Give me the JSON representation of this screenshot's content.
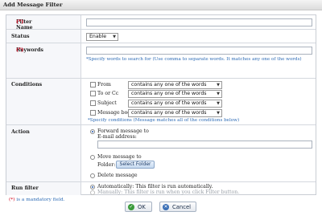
{
  "window": {
    "title": "Add Message Filter"
  },
  "required_marker": "(*)",
  "filter_name": {
    "label": "Filter Name",
    "value": ""
  },
  "status": {
    "label": "Status",
    "selected": "Enable"
  },
  "keywords": {
    "label": "Keywords",
    "value": "",
    "hint": "*Specify words to search for (Use comma to separate words. It matches any one of the words)"
  },
  "conditions": {
    "label": "Conditions",
    "items": [
      {
        "label": "From",
        "checked": false,
        "operator": "contains any one of the words",
        "value": ""
      },
      {
        "label": "To or Cc",
        "checked": false,
        "operator": "contains any one of the words",
        "value": ""
      },
      {
        "label": "Subject",
        "checked": false,
        "operator": "contains any one of the words",
        "value": ""
      },
      {
        "label": "Message body",
        "checked": false,
        "operator": "contains any one of the words",
        "value": ""
      }
    ],
    "hint": "*Specify conditions (Message matches all of the conditions below)"
  },
  "action": {
    "label": "Action",
    "forward": {
      "label": "Forward message to",
      "selected": true,
      "email_label": "E-mail address:",
      "email_value": ""
    },
    "move": {
      "label": "Move message to",
      "selected": false,
      "folder_label": "Folder:",
      "select_folder_button": "Select Folder"
    },
    "delete": {
      "label": "Delete message",
      "selected": false
    }
  },
  "run_filter": {
    "label": "Run filter",
    "automatic": {
      "label": "Automatically: This filter is run automatically.",
      "selected": true
    },
    "manual": {
      "label": "Manually: This filter is run when you click Filter button.",
      "selected": false,
      "disabled": true
    }
  },
  "mandatory_note": {
    "marker": "(*)",
    "text": " is a mandatory field."
  },
  "buttons": {
    "ok": "OK",
    "cancel": "Cancel"
  },
  "colors": {
    "accent": "#2d6bb5",
    "required": "#d0021b",
    "label_bg": "#f6f7fa",
    "border": "#c9cdd4"
  },
  "icons": {
    "ok": "check-icon",
    "cancel": "x-icon"
  }
}
